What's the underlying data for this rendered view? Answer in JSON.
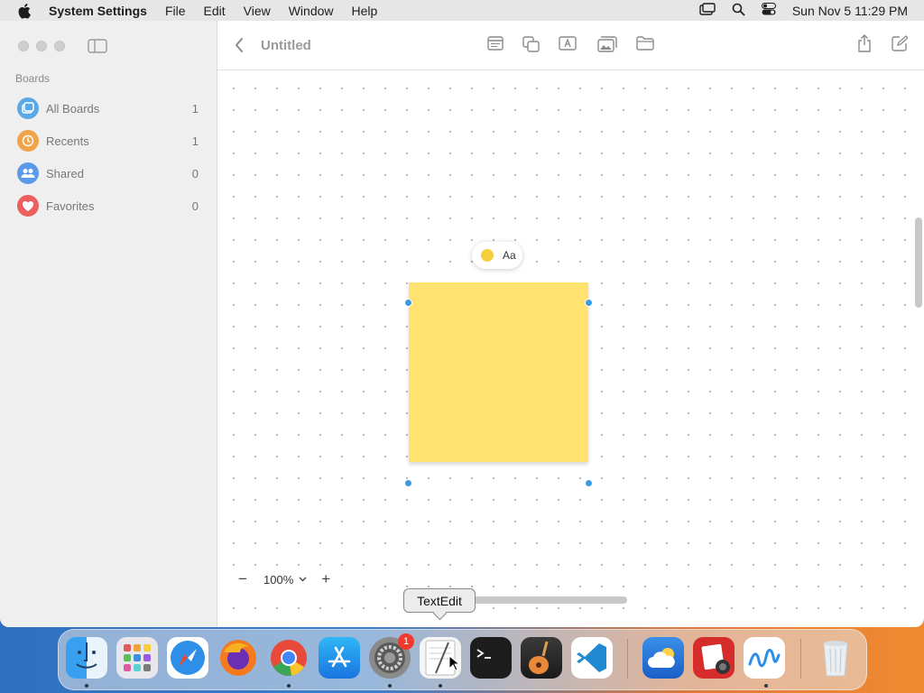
{
  "menubar": {
    "app_name": "System Settings",
    "items": [
      "File",
      "Edit",
      "View",
      "Window",
      "Help"
    ],
    "clock": "Sun Nov 5  11:29 PM"
  },
  "sidebar": {
    "heading": "Boards",
    "items": [
      {
        "label": "All Boards",
        "count": "1",
        "color": "#5aa9e6",
        "icon": "boards-icon"
      },
      {
        "label": "Recents",
        "count": "1",
        "color": "#f0a44a",
        "icon": "clock-icon"
      },
      {
        "label": "Shared",
        "count": "0",
        "color": "#5b9ae8",
        "icon": "people-icon"
      },
      {
        "label": "Favorites",
        "count": "0",
        "color": "#ec5f5f",
        "icon": "heart-icon"
      }
    ]
  },
  "toolbar": {
    "title": "Untitled"
  },
  "canvas": {
    "sticky_color": "#ffe270",
    "popover_label": "Aa"
  },
  "zoom": {
    "value": "100%"
  },
  "tooltip": "TextEdit",
  "dock": {
    "badge": "1",
    "apps": [
      "Finder",
      "Launchpad",
      "Safari",
      "Firefox",
      "Chrome",
      "App Store",
      "System Settings",
      "TextEdit",
      "Terminal",
      "GarageBand",
      "VS Code",
      "Weather",
      "Photo Booth",
      "Freeform",
      "Trash"
    ]
  }
}
